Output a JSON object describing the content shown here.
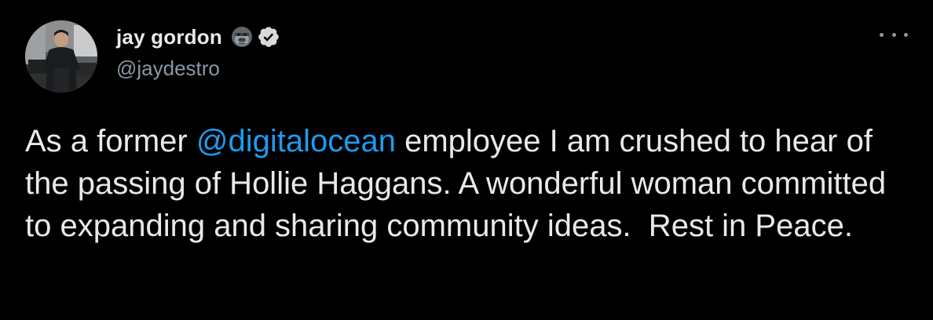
{
  "author": {
    "display_name": "jay gordon",
    "handle": "@jaydestro",
    "emoji_icon": "gorilla-icon",
    "verified_icon": "verified-badge-icon",
    "avatar": "profile-photo"
  },
  "menu": {
    "icon": "more-options-icon"
  },
  "tweet": {
    "text_before": "As a former ",
    "mention": "@digitalocean",
    "text_after": " employee I am crushed to hear of the passing of Hollie Haggans. A wonderful woman committed to expanding and sharing community ideas.  Rest in Peace."
  },
  "colors": {
    "background": "#000000",
    "text": "#e7e9ea",
    "muted": "#8b98a5",
    "link": "#1d9bf0"
  }
}
